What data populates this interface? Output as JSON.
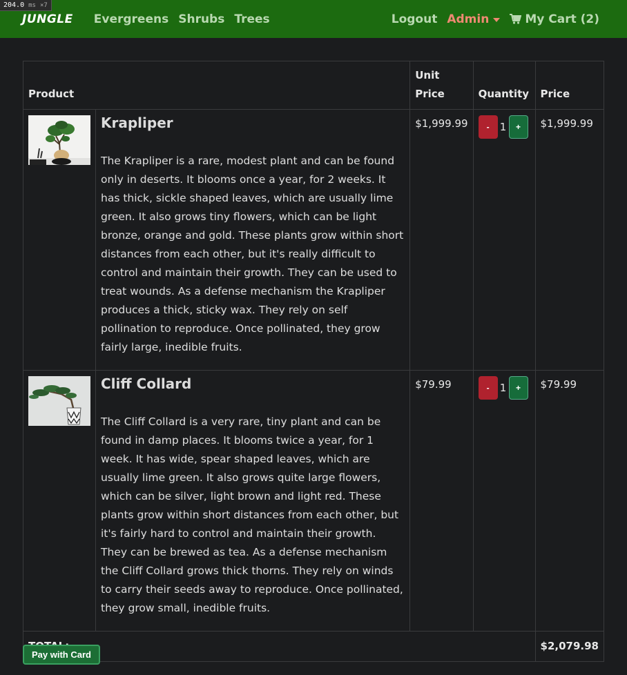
{
  "perf": {
    "time": "204.0",
    "unit": "ms",
    "mult": "×7"
  },
  "nav": {
    "brand": "JUNGLE",
    "links": [
      "Evergreens",
      "Shrubs",
      "Trees"
    ],
    "logout": "Logout",
    "admin": "Admin",
    "cart": "My Cart (2)"
  },
  "table": {
    "headers": {
      "product": "Product",
      "unit_price": "Unit Price",
      "quantity": "Quantity",
      "price": "Price"
    },
    "rows": [
      {
        "name": "Krapliper",
        "description": "The Krapliper is a rare, modest plant and can be found only in deserts. It blooms once a year, for 2 weeks. It has thick, sickle shaped leaves, which are usually lime green. It also grows tiny flowers, which can be light bronze, orange and gold. These plants grow within short distances from each other, but it's really difficult to control and maintain their growth. They can be used to treat wounds. As a defense mechanism the Krapliper produces a thick, sticky wax. They rely on self pollination to reproduce. Once pollinated, they grow fairly large, inedible fruits.",
        "unit_price": "$1,999.99",
        "quantity": "1",
        "price": "$1,999.99"
      },
      {
        "name": "Cliff Collard",
        "description": "The Cliff Collard is a very rare, tiny plant and can be found in damp places. It blooms twice a year, for 1 week. It has wide, spear shaped leaves, which are usually lime green. It also grows quite large flowers, which can be silver, light brown and light red. These plants grow within short distances from each other, but it's fairly hard to control and maintain their growth. They can be brewed as tea. As a defense mechanism the Cliff Collard grows thick thorns. They rely on winds to carry their seeds away to reproduce. Once pollinated, they grow small, inedible fruits.",
        "unit_price": "$79.99",
        "quantity": "1",
        "price": "$79.99"
      }
    ],
    "minus_label": "-",
    "plus_label": "+",
    "total_label": "TOTAL:",
    "total_value": "$2,079.98"
  },
  "pay_button": "Pay with Card",
  "colors": {
    "navbar": "#1c6b10",
    "admin": "#ee8a72",
    "minus": "#b0222e",
    "plus": "#166c3a"
  }
}
